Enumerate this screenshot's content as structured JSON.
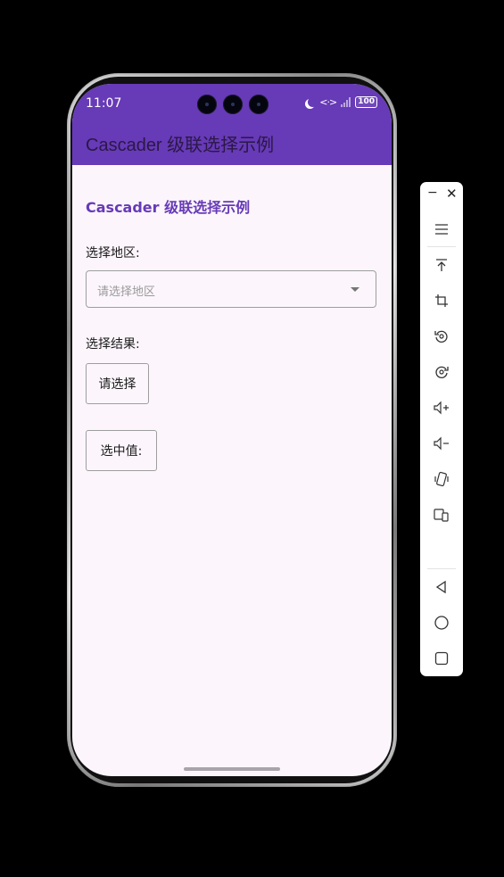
{
  "status_bar": {
    "time": "11:07",
    "data_glyph": "<·>",
    "battery": "100"
  },
  "app_bar": {
    "title": "Cascader 级联选择示例"
  },
  "page": {
    "heading": "Cascader 级联选择示例",
    "region_label": "选择地区:",
    "cascader_placeholder": "请选择地区",
    "result_label": "选择结果:",
    "select_button": "请选择",
    "value_button": "选中值:"
  },
  "side_toolbar": {
    "minimize_glyph": "−",
    "close_glyph": "✕",
    "items": [
      "menu-icon",
      "pin-top-icon",
      "crop-icon",
      "rotate-left-icon",
      "rotate-right-icon",
      "volume-up-icon",
      "volume-down-icon",
      "shake-icon",
      "multi-device-icon",
      "back-icon",
      "home-icon",
      "recents-icon"
    ]
  },
  "colors": {
    "primary": "#673ab7",
    "background": "#fcf6fc",
    "outline": "#9e9e9e"
  }
}
